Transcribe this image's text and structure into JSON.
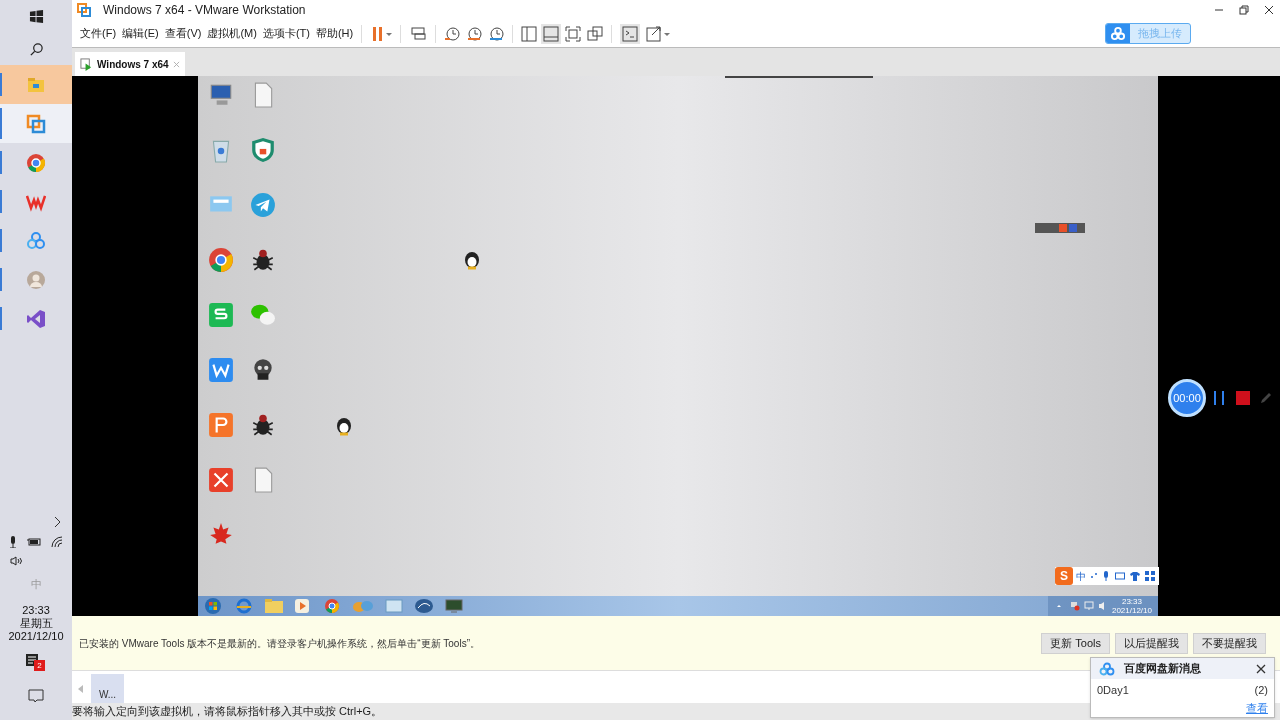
{
  "host_taskbar": {
    "apps": [
      {
        "kind": "explorer",
        "highlighted": true,
        "selected": false
      },
      {
        "kind": "vmware",
        "highlighted": false,
        "selected": true
      },
      {
        "kind": "chrome",
        "highlighted": false,
        "selected": false
      },
      {
        "kind": "wps",
        "highlighted": false,
        "selected": false
      },
      {
        "kind": "baidu",
        "highlighted": false,
        "selected": false
      },
      {
        "kind": "avatar",
        "highlighted": false,
        "selected": false
      },
      {
        "kind": "vs",
        "highlighted": false,
        "selected": false
      }
    ],
    "ime": "中",
    "clock": {
      "time": "23:33",
      "day": "星期五",
      "date": "2021/12/10"
    },
    "notification_count": "2"
  },
  "window": {
    "title": "Windows 7 x64 - VMware Workstation",
    "menu": [
      "文件(F)",
      "编辑(E)",
      "查看(V)",
      "虚拟机(M)",
      "选项卡(T)",
      "帮助(H)"
    ],
    "upload_button": "拖拽上传",
    "tabs": [
      {
        "label": "Windows 7 x64",
        "selected": true
      }
    ]
  },
  "guest": {
    "desktop_icons": [
      {
        "kind": "computer"
      },
      {
        "kind": "file"
      },
      {
        "kind": "recycle"
      },
      {
        "kind": "shield"
      },
      {
        "kind": "control"
      },
      {
        "kind": "telegram"
      },
      {
        "kind": "chrome"
      },
      {
        "kind": "bug"
      },
      {
        "kind": "wps-sheet"
      },
      {
        "kind": "wechat"
      },
      {
        "kind": "wps-writer"
      },
      {
        "kind": "skull"
      },
      {
        "kind": "wps-slides"
      },
      {
        "kind": "bug"
      },
      {
        "kind": "xmind"
      },
      {
        "kind": "file"
      },
      {
        "kind": "maple"
      }
    ],
    "ime_logo": "S",
    "ime_label": "中",
    "clock": {
      "time": "23:33",
      "date": "2021/12/10"
    }
  },
  "info_bar": {
    "message": "已安装的 VMware Tools 版本不是最新的。请登录客户机操作系统，然后单击“更新 Tools”。",
    "buttons": [
      "更新 Tools",
      "以后提醒我",
      "不要提醒我"
    ]
  },
  "thumbnail": {
    "label": "W..."
  },
  "status_bar": "要将输入定向到该虚拟机，请将鼠标指针移入其中或按 Ctrl+G。",
  "baidu_popup": {
    "title": "百度网盘新消息",
    "item": "0Day1",
    "count": "(2)",
    "link": "查看"
  },
  "recorder": {
    "time": "00:00"
  }
}
